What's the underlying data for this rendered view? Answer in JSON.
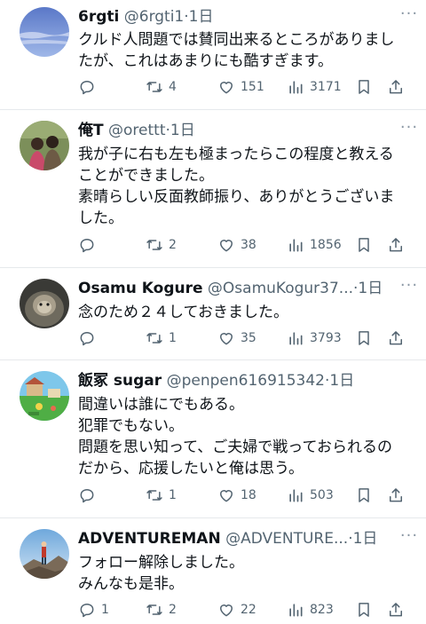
{
  "tweets": [
    {
      "name": "6rgti",
      "handle": "@6rgti1",
      "time": "·1日",
      "lines": [
        "クルド人問題では賛同出来るところがありまし",
        "たが、これはあまりにも酷すぎます。"
      ],
      "replies": "",
      "retweets": "4",
      "likes": "151",
      "views": "3171",
      "avatar": "blue-sky-avatar"
    },
    {
      "name": "俺T",
      "handle": "@orettt",
      "time": "·1日",
      "lines": [
        "我が子に右も左も極まったらこの程度と教える",
        "ことができました。",
        "素晴らしい反面教師振り、ありがとうございま",
        "した。"
      ],
      "replies": "",
      "retweets": "2",
      "likes": "38",
      "views": "1856",
      "avatar": "children-photo-avatar"
    },
    {
      "name": "Osamu Kogure",
      "handle": "@OsamuKogur37...",
      "time": "·1日",
      "lines": [
        "念のため２４しておきました。"
      ],
      "replies": "",
      "retweets": "1",
      "likes": "35",
      "views": "3793",
      "avatar": "animal-photo-avatar"
    },
    {
      "name": "飯冢 sugar",
      "handle": "@penpen616915342",
      "time": "·1日",
      "lines": [
        "間違いは誰にでもある。",
        "犯罪でもない。",
        "問題を思い知って、ご夫婦で戦っておられるの",
        "だから、応援したいと俺は思う。"
      ],
      "replies": "",
      "retweets": "1",
      "likes": "18",
      "views": "503",
      "avatar": "game-scene-avatar"
    },
    {
      "name": "ADVENTUREMAN",
      "handle": "@ADVENTURE...",
      "time": "·1日",
      "lines": [
        "フォロー解除しました。",
        "みんなも是非。"
      ],
      "replies": "1",
      "retweets": "2",
      "likes": "22",
      "views": "823",
      "avatar": "hiker-photo-avatar"
    }
  ],
  "icons": {
    "reply": "reply-icon",
    "retweet": "retweet-icon",
    "like": "heart-icon",
    "views": "views-chart-icon",
    "bookmark": "bookmark-icon",
    "share": "share-icon",
    "more": "more-dots-icon"
  },
  "colors": {
    "text": "#0f1419",
    "secondary": "#536471",
    "divider": "#e6e9ec",
    "background": "#ffffff"
  },
  "more_glyph": "···"
}
